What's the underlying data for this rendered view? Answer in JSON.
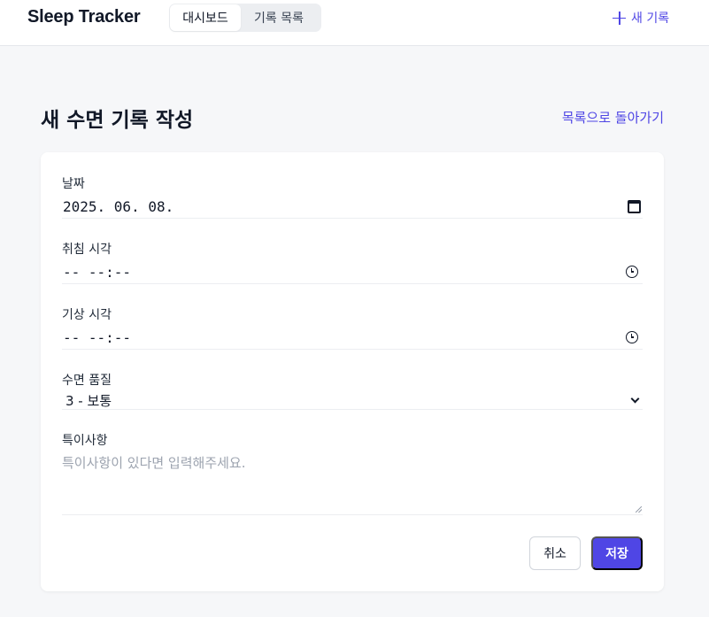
{
  "header": {
    "brand": "Sleep Tracker",
    "tabs": [
      {
        "label": "대시보드",
        "active": true
      },
      {
        "label": "기록 목록",
        "active": false
      }
    ],
    "new_record_label": "새 기록"
  },
  "page": {
    "title": "새 수면 기록 작성",
    "back_link": "목록으로 돌아가기"
  },
  "form": {
    "date": {
      "label": "날짜",
      "value": "2025. 06. 08."
    },
    "bedtime": {
      "label": "취침 시각",
      "value": "-- --:--"
    },
    "wake_time": {
      "label": "기상 시각",
      "value": "-- --:--"
    },
    "quality": {
      "label": "수면 품질",
      "value": "3 - 보통"
    },
    "notes": {
      "label": "특이사항",
      "placeholder": "특이사항이 있다면 입력해주세요."
    },
    "cancel_label": "취소",
    "save_label": "저장"
  },
  "colors": {
    "accent": "#4f46e5",
    "background": "#f6f7f9",
    "card": "#ffffff"
  }
}
